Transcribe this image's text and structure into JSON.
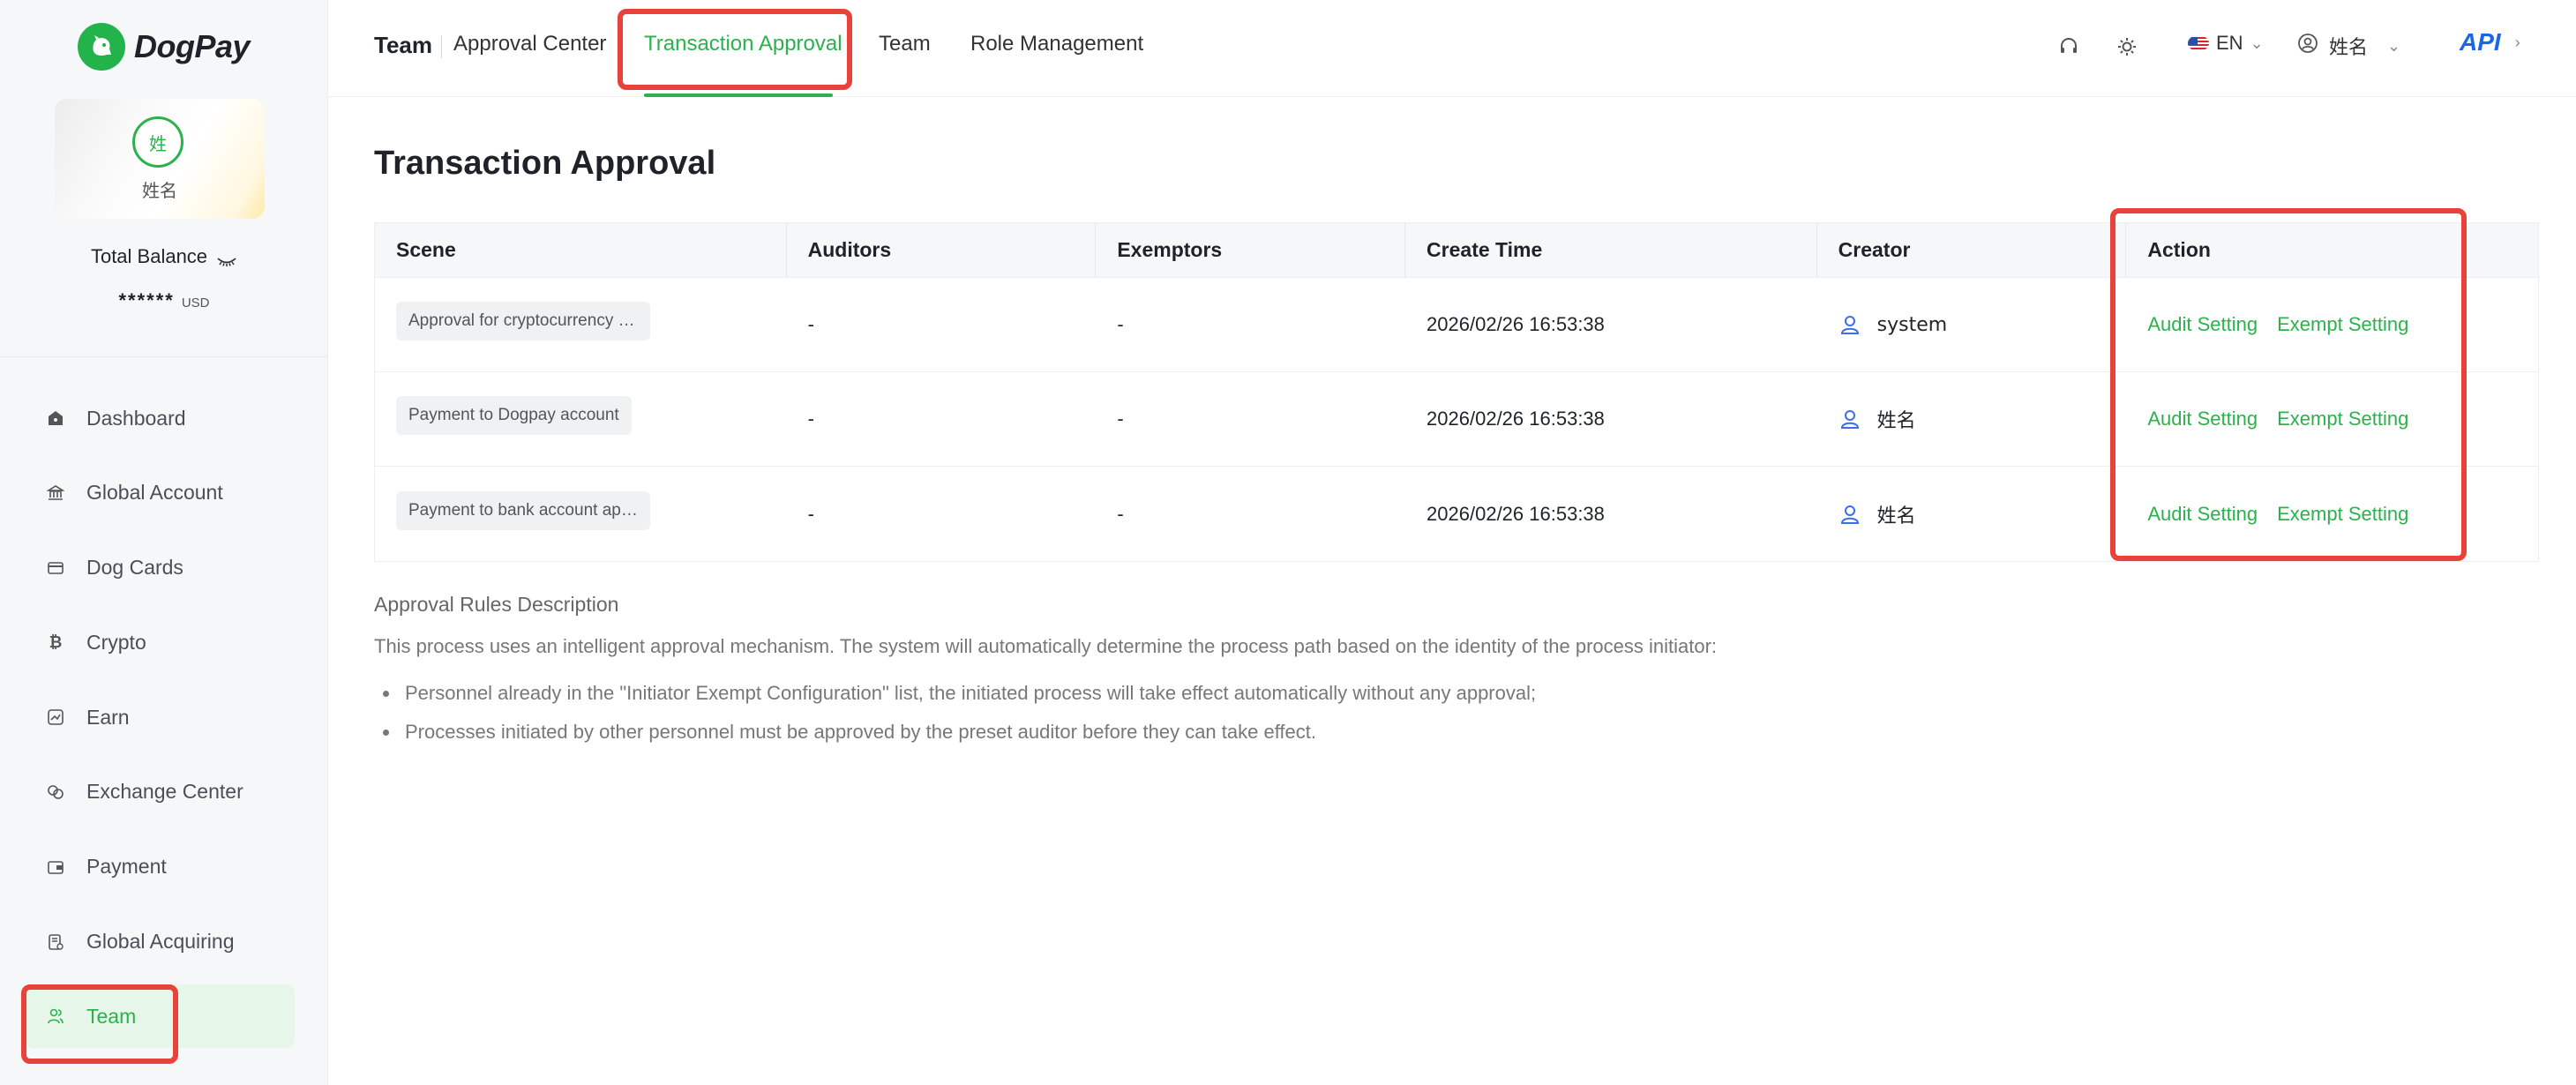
{
  "brand": {
    "name": "DogPay",
    "color": "#2bb24c"
  },
  "profile": {
    "avatar_initial": "姓",
    "name": "姓名"
  },
  "balance": {
    "label": "Total Balance",
    "masked_value": "******",
    "currency": "USD"
  },
  "sidebar": {
    "items": [
      {
        "label": "Dashboard",
        "icon": "dashboard-icon",
        "active": false
      },
      {
        "label": "Global Account",
        "icon": "bank-icon",
        "active": false
      },
      {
        "label": "Dog Cards",
        "icon": "card-icon",
        "active": false
      },
      {
        "label": "Crypto",
        "icon": "bitcoin-icon",
        "active": false
      },
      {
        "label": "Earn",
        "icon": "earn-icon",
        "active": false
      },
      {
        "label": "Exchange Center",
        "icon": "exchange-icon",
        "active": false
      },
      {
        "label": "Payment",
        "icon": "wallet-icon",
        "active": false
      },
      {
        "label": "Global Acquiring",
        "icon": "acquiring-icon",
        "active": false
      },
      {
        "label": "Team",
        "icon": "team-icon",
        "active": true
      }
    ]
  },
  "header": {
    "section_title": "Team",
    "tabs": [
      {
        "label": "Approval Center",
        "active": false
      },
      {
        "label": "Transaction Approval",
        "active": true
      },
      {
        "label": "Team",
        "active": false
      },
      {
        "label": "Role Management",
        "active": false
      }
    ],
    "language": "EN",
    "user_name": "姓名",
    "api_label": "API"
  },
  "main": {
    "title": "Transaction Approval",
    "table": {
      "columns": [
        "Scene",
        "Auditors",
        "Exemptors",
        "Create Time",
        "Creator",
        "Action"
      ],
      "rows": [
        {
          "scene": "Approval for cryptocurrency withdrawal",
          "auditors": "-",
          "exemptors": "-",
          "create_time": "2026/02/26 16:53:38",
          "creator": "system"
        },
        {
          "scene": "Payment to Dogpay account",
          "auditors": "-",
          "exemptors": "-",
          "create_time": "2026/02/26 16:53:38",
          "creator": "姓名"
        },
        {
          "scene": "Payment to bank account approval",
          "auditors": "-",
          "exemptors": "-",
          "create_time": "2026/02/26 16:53:38",
          "creator": "姓名"
        }
      ],
      "actions": {
        "audit": "Audit Setting",
        "exempt": "Exempt Setting"
      }
    },
    "rules": {
      "title": "Approval Rules Description",
      "intro": "This process uses an intelligent approval mechanism. The system will automatically determine the process path based on the identity of the process initiator:",
      "points": [
        "Personnel already in the \"Initiator Exempt Configuration\" list, the initiated process will take effect automatically without any approval;",
        "Processes initiated by other personnel must be approved by the preset auditor before they can take effect."
      ]
    }
  },
  "colors": {
    "accent": "#2bb24c",
    "highlight": "#e8423b",
    "api": "#1a67e6",
    "creator_icon": "#3b6ee8"
  }
}
